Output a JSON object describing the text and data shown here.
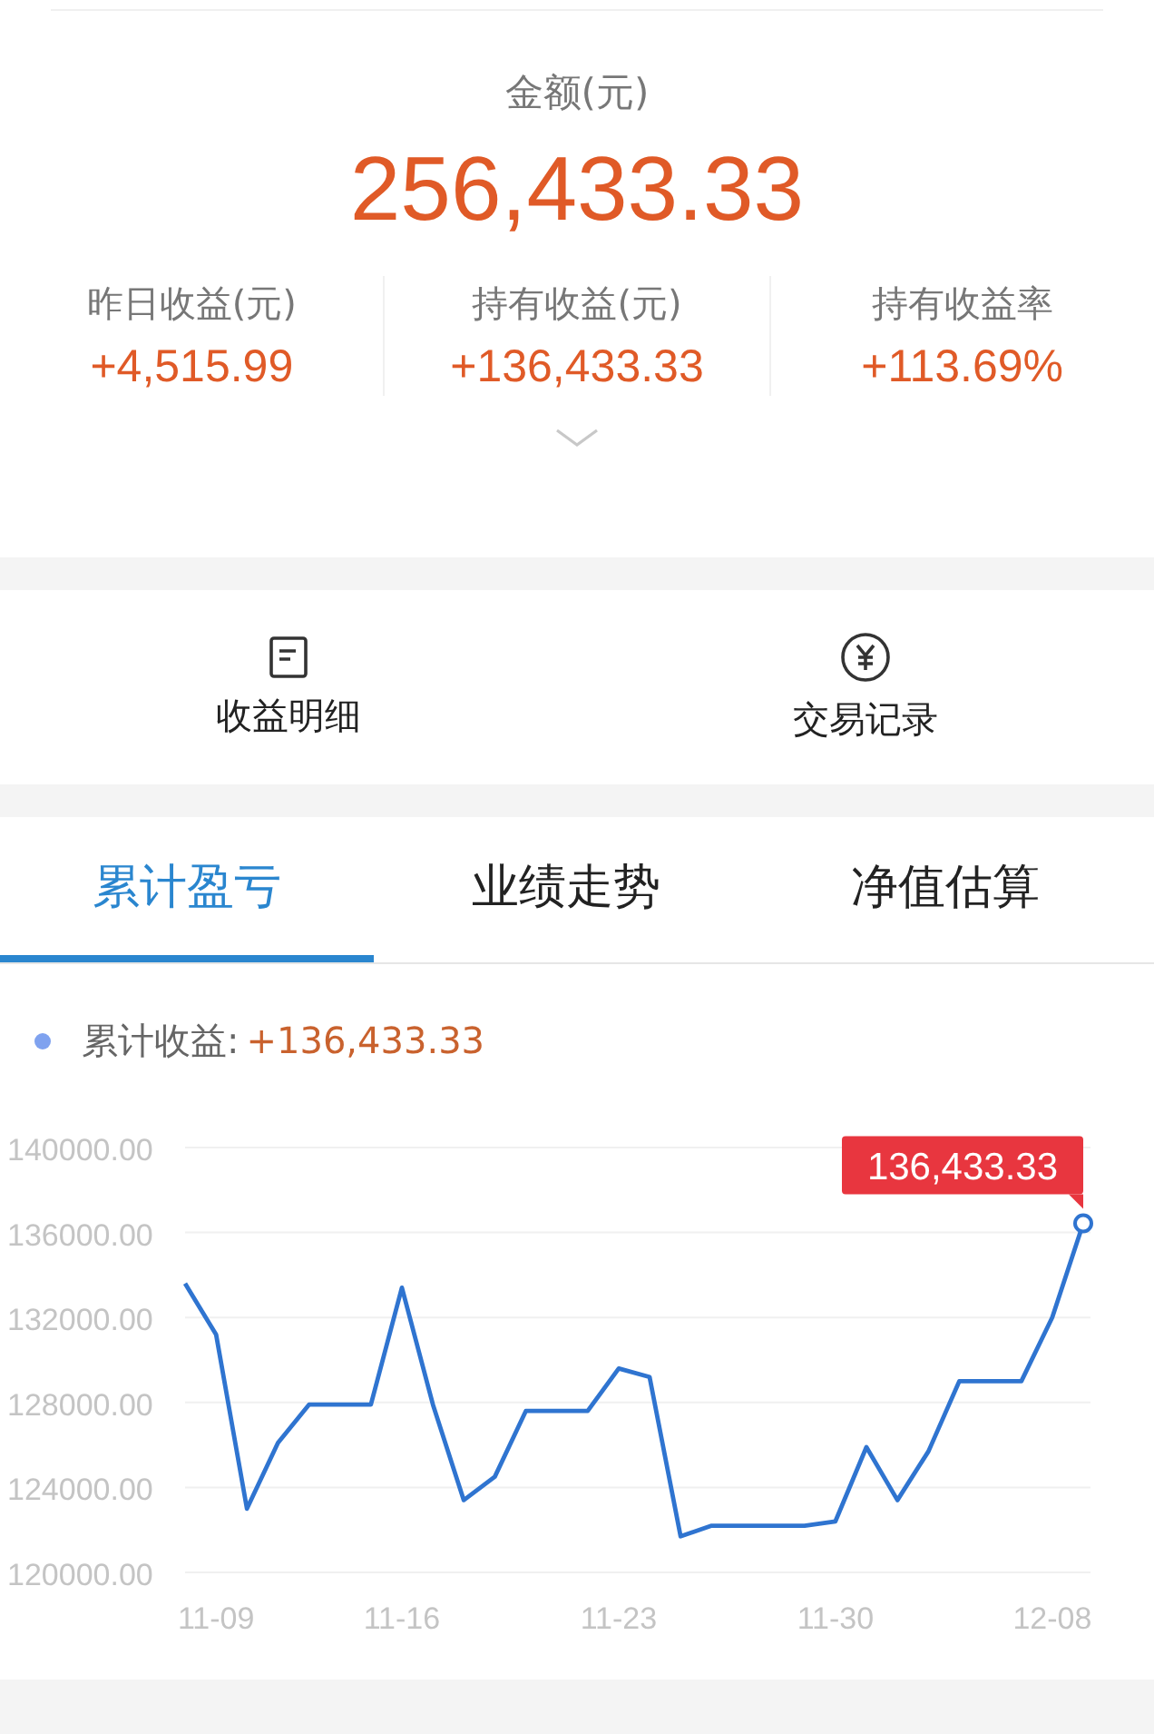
{
  "summary": {
    "label": "金额(元)",
    "amount": "256,433.33"
  },
  "stats": [
    {
      "label": "昨日收益(元)",
      "value": "+4,515.99"
    },
    {
      "label": "持有收益(元)",
      "value": "+136,433.33"
    },
    {
      "label": "持有收益率",
      "value": "+113.69%"
    }
  ],
  "actions": [
    {
      "kind": "document",
      "label": "收益明细"
    },
    {
      "kind": "yuan",
      "label": "交易记录"
    }
  ],
  "tabs": [
    {
      "label": "累计盈亏",
      "selected": true
    },
    {
      "label": "业绩走势",
      "selected": false
    },
    {
      "label": "净值估算",
      "selected": false
    }
  ],
  "legend": {
    "value": "+136,433.33"
  },
  "chart_data": {
    "type": "line",
    "categories": [
      null,
      "11-09",
      null,
      null,
      null,
      null,
      null,
      "11-16",
      null,
      null,
      null,
      null,
      null,
      null,
      "11-23",
      null,
      null,
      null,
      null,
      null,
      null,
      "11-30",
      null,
      null,
      null,
      null,
      null,
      null,
      "12-08",
      null
    ],
    "grid": true,
    "series": [
      {
        "name": "累计收益:",
        "color": "#2f74d0",
        "values": [
          133600,
          131200,
          123000,
          126100,
          127900,
          127900,
          127900,
          133400,
          127900,
          123400,
          124500,
          127600,
          127600,
          127600,
          129600,
          129200,
          121700,
          122200,
          122200,
          122200,
          122200,
          122400,
          125900,
          123400,
          125700,
          129000,
          129000,
          129000,
          132000,
          136433.33
        ]
      }
    ],
    "ylim": [
      120000,
      140000
    ],
    "yticks": [
      {
        "value": 140000,
        "label": "140000.00"
      },
      {
        "value": 136000,
        "label": "136000.00"
      },
      {
        "value": 132000,
        "label": "132000.00"
      },
      {
        "value": 128000,
        "label": "128000.00"
      },
      {
        "value": 124000,
        "label": "124000.00"
      },
      {
        "value": 120000,
        "label": "120000.00"
      }
    ],
    "annotations": [
      "136,433.33"
    ]
  }
}
